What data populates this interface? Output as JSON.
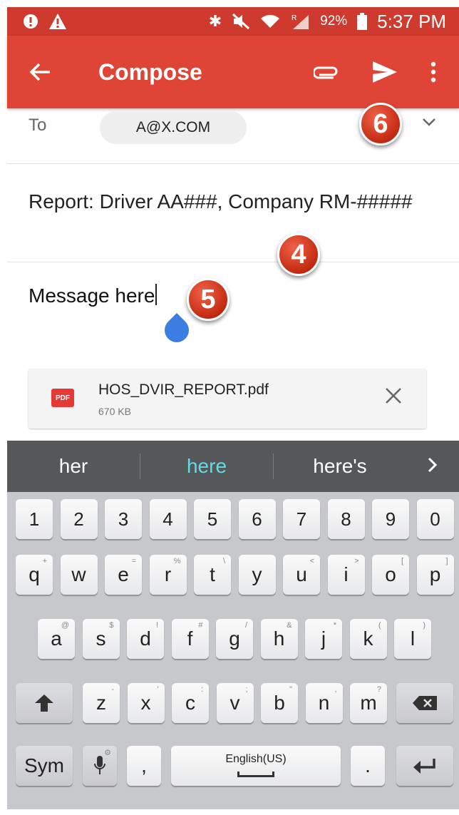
{
  "status_bar": {
    "signal_label": "R",
    "battery": "92%",
    "time": "5:37 PM"
  },
  "app_bar": {
    "title": "Compose"
  },
  "compose": {
    "to_label": "To",
    "to_recipient": "A@X.COM",
    "subject": "Report: Driver AA###, Company RM-#####",
    "body": "Message here",
    "attachment": {
      "name": "HOS_DVIR_REPORT.pdf",
      "size": "670 KB",
      "type_label": "PDF"
    }
  },
  "callouts": {
    "four": "4",
    "five": "5",
    "six": "6"
  },
  "suggestions": {
    "left": "her",
    "middle": "here",
    "right": "here's"
  },
  "keyboard": {
    "number_row": [
      "1",
      "2",
      "3",
      "4",
      "5",
      "6",
      "7",
      "8",
      "9",
      "0"
    ],
    "row1": [
      "q",
      "w",
      "e",
      "r",
      "t",
      "y",
      "u",
      "i",
      "o",
      "p"
    ],
    "row1_hints": [
      "+",
      "×",
      "÷",
      "=",
      "/",
      "_",
      "<",
      ">",
      "[",
      "]"
    ],
    "row1_hints_visible": [
      "+",
      "",
      "=",
      "%",
      "\\",
      "",
      "<",
      ">",
      "[",
      "]"
    ],
    "row2": [
      "a",
      "s",
      "d",
      "f",
      "g",
      "h",
      "j",
      "k",
      "l"
    ],
    "row2_hints": [
      "@",
      "$",
      "!",
      "#",
      "/",
      "&",
      "*",
      "(",
      ")"
    ],
    "row3": [
      "z",
      "x",
      "c",
      "v",
      "b",
      "n",
      "m"
    ],
    "row3_hints": [
      "-",
      "'",
      ":",
      ";",
      "\"",
      ",",
      "?"
    ],
    "sym_label": "Sym",
    "comma": ",",
    "space_label": "English(US)",
    "period": "."
  },
  "colors": {
    "status_bar": "#cf3a2f",
    "app_bar": "#df4436",
    "suggestion_highlight": "#5fdde6",
    "cursor_handle": "#3b7de0"
  }
}
